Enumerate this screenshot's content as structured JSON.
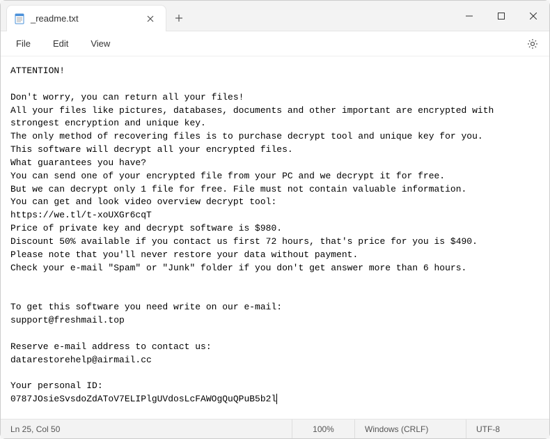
{
  "titlebar": {
    "tab_label": "_readme.txt",
    "notepad_icon": "notepad-icon",
    "close_icon": "close-icon",
    "new_tab_icon": "plus-icon",
    "minimize_icon": "minimize-icon",
    "maximize_icon": "maximize-icon",
    "window_close_icon": "close-icon"
  },
  "menubar": {
    "items": [
      "File",
      "Edit",
      "View"
    ],
    "settings_icon": "gear-icon"
  },
  "document": {
    "lines": [
      "ATTENTION!",
      "",
      "Don't worry, you can return all your files!",
      "All your files like pictures, databases, documents and other important are encrypted with strongest encryption and unique key.",
      "The only method of recovering files is to purchase decrypt tool and unique key for you.",
      "This software will decrypt all your encrypted files.",
      "What guarantees you have?",
      "You can send one of your encrypted file from your PC and we decrypt it for free.",
      "But we can decrypt only 1 file for free. File must not contain valuable information.",
      "You can get and look video overview decrypt tool:",
      "https://we.tl/t-xoUXGr6cqT",
      "Price of private key and decrypt software is $980.",
      "Discount 50% available if you contact us first 72 hours, that's price for you is $490.",
      "Please note that you'll never restore your data without payment.",
      "Check your e-mail \"Spam\" or \"Junk\" folder if you don't get answer more than 6 hours.",
      "",
      "",
      "To get this software you need write on our e-mail:",
      "support@freshmail.top",
      "",
      "Reserve e-mail address to contact us:",
      "datarestorehelp@airmail.cc",
      "",
      "Your personal ID:",
      "0787JOsieSvsdoZdAToV7ELIPlgUVdosLcFAWOgQuQPuB5b2l"
    ]
  },
  "statusbar": {
    "position": "Ln 25, Col 50",
    "zoom": "100%",
    "eol": "Windows (CRLF)",
    "encoding": "UTF-8"
  }
}
